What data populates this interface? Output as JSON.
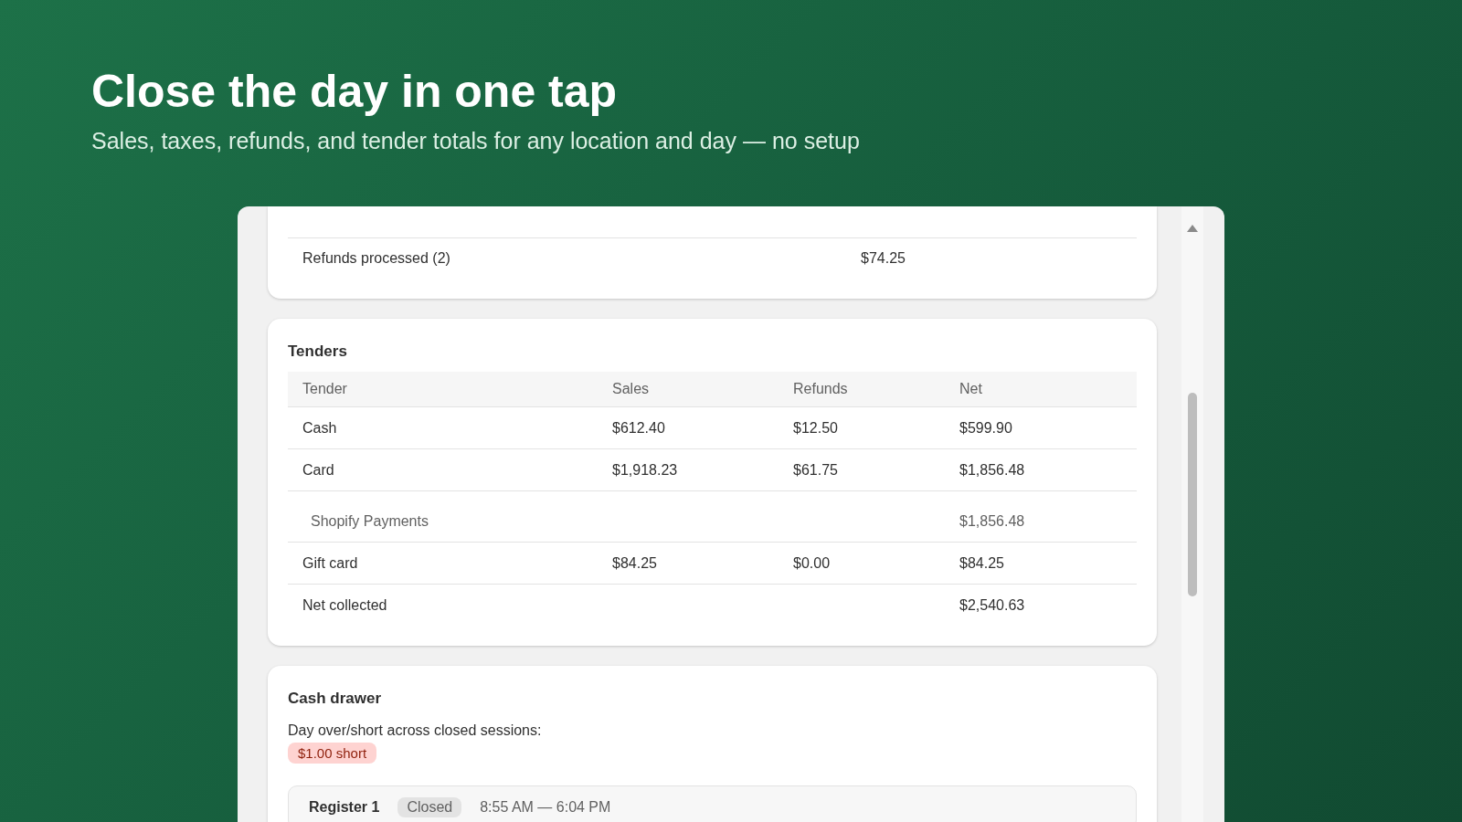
{
  "headline": "Close the day in one tap",
  "subheadline": "Sales, taxes, refunds, and tender totals for any location and day — no setup",
  "refunds_card": {
    "label": "Refunds processed (2)",
    "value": "$74.25"
  },
  "tenders": {
    "title": "Tenders",
    "columns": [
      "Tender",
      "Sales",
      "Refunds",
      "Net"
    ],
    "rows": [
      {
        "kind": "tender",
        "cells": [
          "Cash",
          "$612.40",
          "$12.50",
          "$599.90"
        ]
      },
      {
        "kind": "tender",
        "cells": [
          "Card",
          "$1,918.23",
          "$61.75",
          "$1,856.48"
        ]
      },
      {
        "kind": "sub",
        "cells": [
          "Shopify Payments",
          "",
          "",
          "$1,856.48"
        ]
      },
      {
        "kind": "tender",
        "cells": [
          "Gift card",
          "$84.25",
          "$0.00",
          "$84.25"
        ]
      },
      {
        "kind": "total",
        "cells": [
          "Net collected",
          "",
          "",
          "$2,540.63"
        ]
      }
    ]
  },
  "cash_drawer": {
    "title": "Cash drawer",
    "summary": "Day over/short across closed sessions:",
    "badge": "$1.00 short",
    "sessions": [
      {
        "name": "Register 1",
        "status": "Closed",
        "time": "8:55 AM — 6:04 PM"
      }
    ]
  }
}
